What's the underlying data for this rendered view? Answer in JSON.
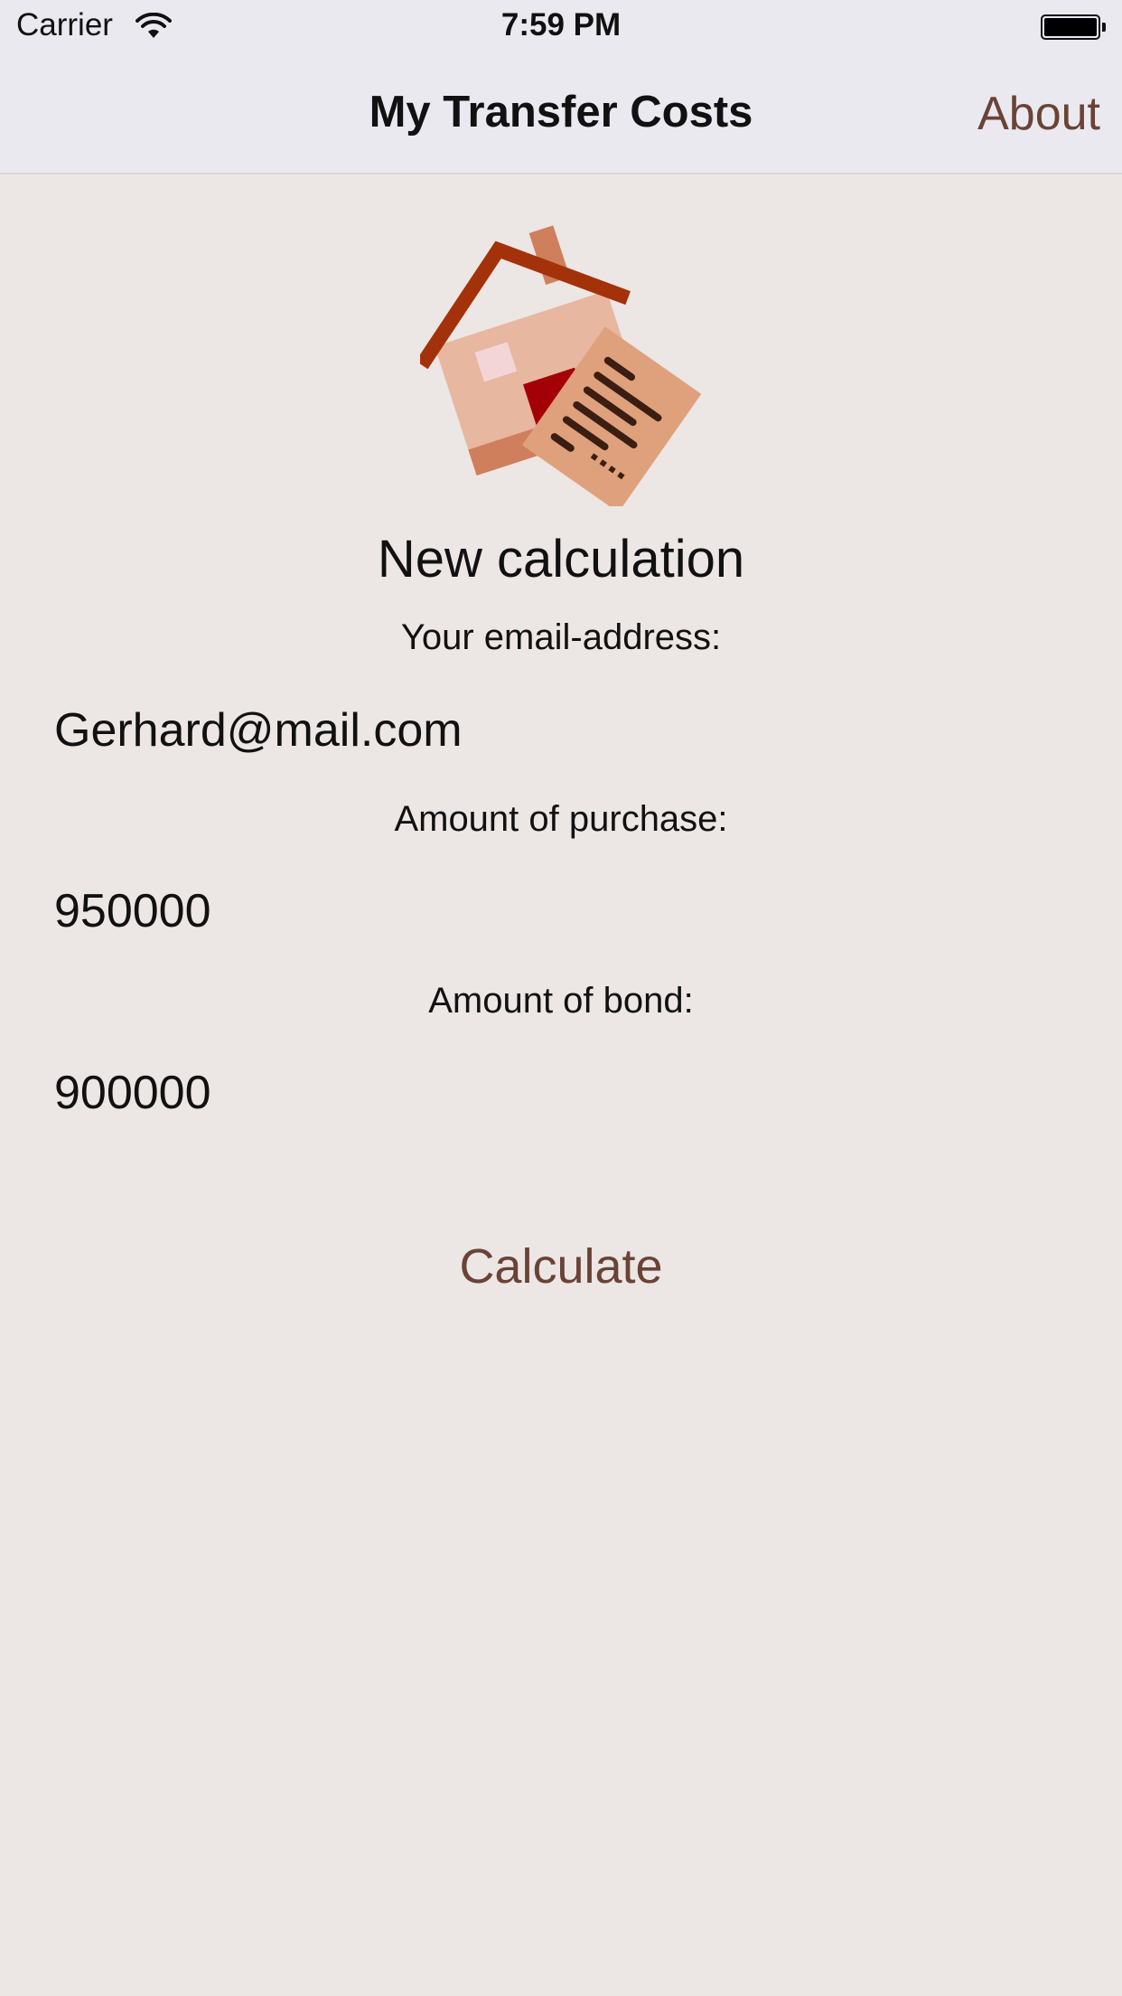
{
  "status_bar": {
    "carrier": "Carrier",
    "time": "7:59 PM"
  },
  "nav": {
    "title": "My Transfer Costs",
    "about_label": "About"
  },
  "logo": {
    "icon": "house-with-document-icon"
  },
  "form": {
    "heading": "New calculation",
    "email_label": "Your email-address:",
    "email_value": "Gerhard@mail.com",
    "purchase_label": "Amount of purchase:",
    "purchase_value": "950000",
    "bond_label": "Amount of bond:",
    "bond_value": "900000",
    "calculate_label": "Calculate"
  },
  "colors": {
    "background": "#ece6e4",
    "accent": "#6a4336",
    "bar": "#eae9ef"
  }
}
